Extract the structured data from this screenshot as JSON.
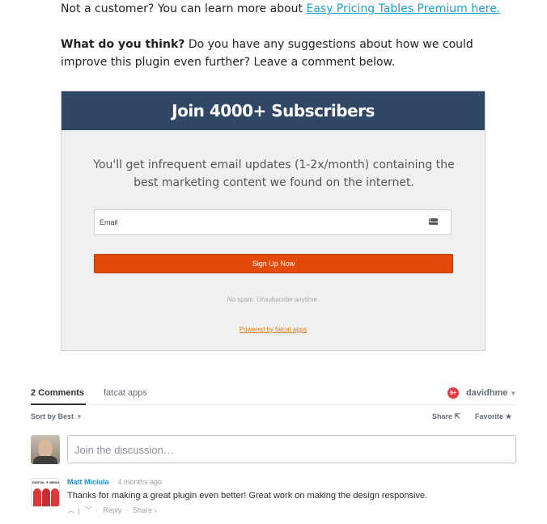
{
  "article": {
    "p1_prefix": "Not a customer? You can learn more about ",
    "p1_link": "Easy Pricing Tables Premium here.",
    "p2_bold": "What do you think?",
    "p2_rest": " Do you have any suggestions about how we could improve this plugin even further? Leave a comment below."
  },
  "optin": {
    "headline": "Join 4000+ Subscribers",
    "description": "You'll get infrequent email updates (1-2x/month) containing the best marketing content we found on the internet.",
    "email_placeholder": "Email",
    "signup_label": "Sign Up Now",
    "nospam": "No spam. Unsubscribe anytime.",
    "powered": "Powered by fatcat apps",
    "colors": {
      "header": "#304766",
      "button": "#e34a0c",
      "link": "#1aa1d6"
    }
  },
  "comments": {
    "count_label": "2 Comments",
    "site_name": "fatcat apps",
    "notification_badge": "9+",
    "username": "davidhme",
    "sort_label": "Sort by Best",
    "share_label": "Share",
    "favorite_label": "Favorite",
    "input_placeholder": "Join the discussion…",
    "list": [
      {
        "author": "Matt Miciula",
        "time": "4 months ago",
        "text": "Thanks for making a great plugin even better! Great work on making the design responsive.",
        "reply_label": "Reply",
        "share_label": "Share ›"
      }
    ]
  }
}
